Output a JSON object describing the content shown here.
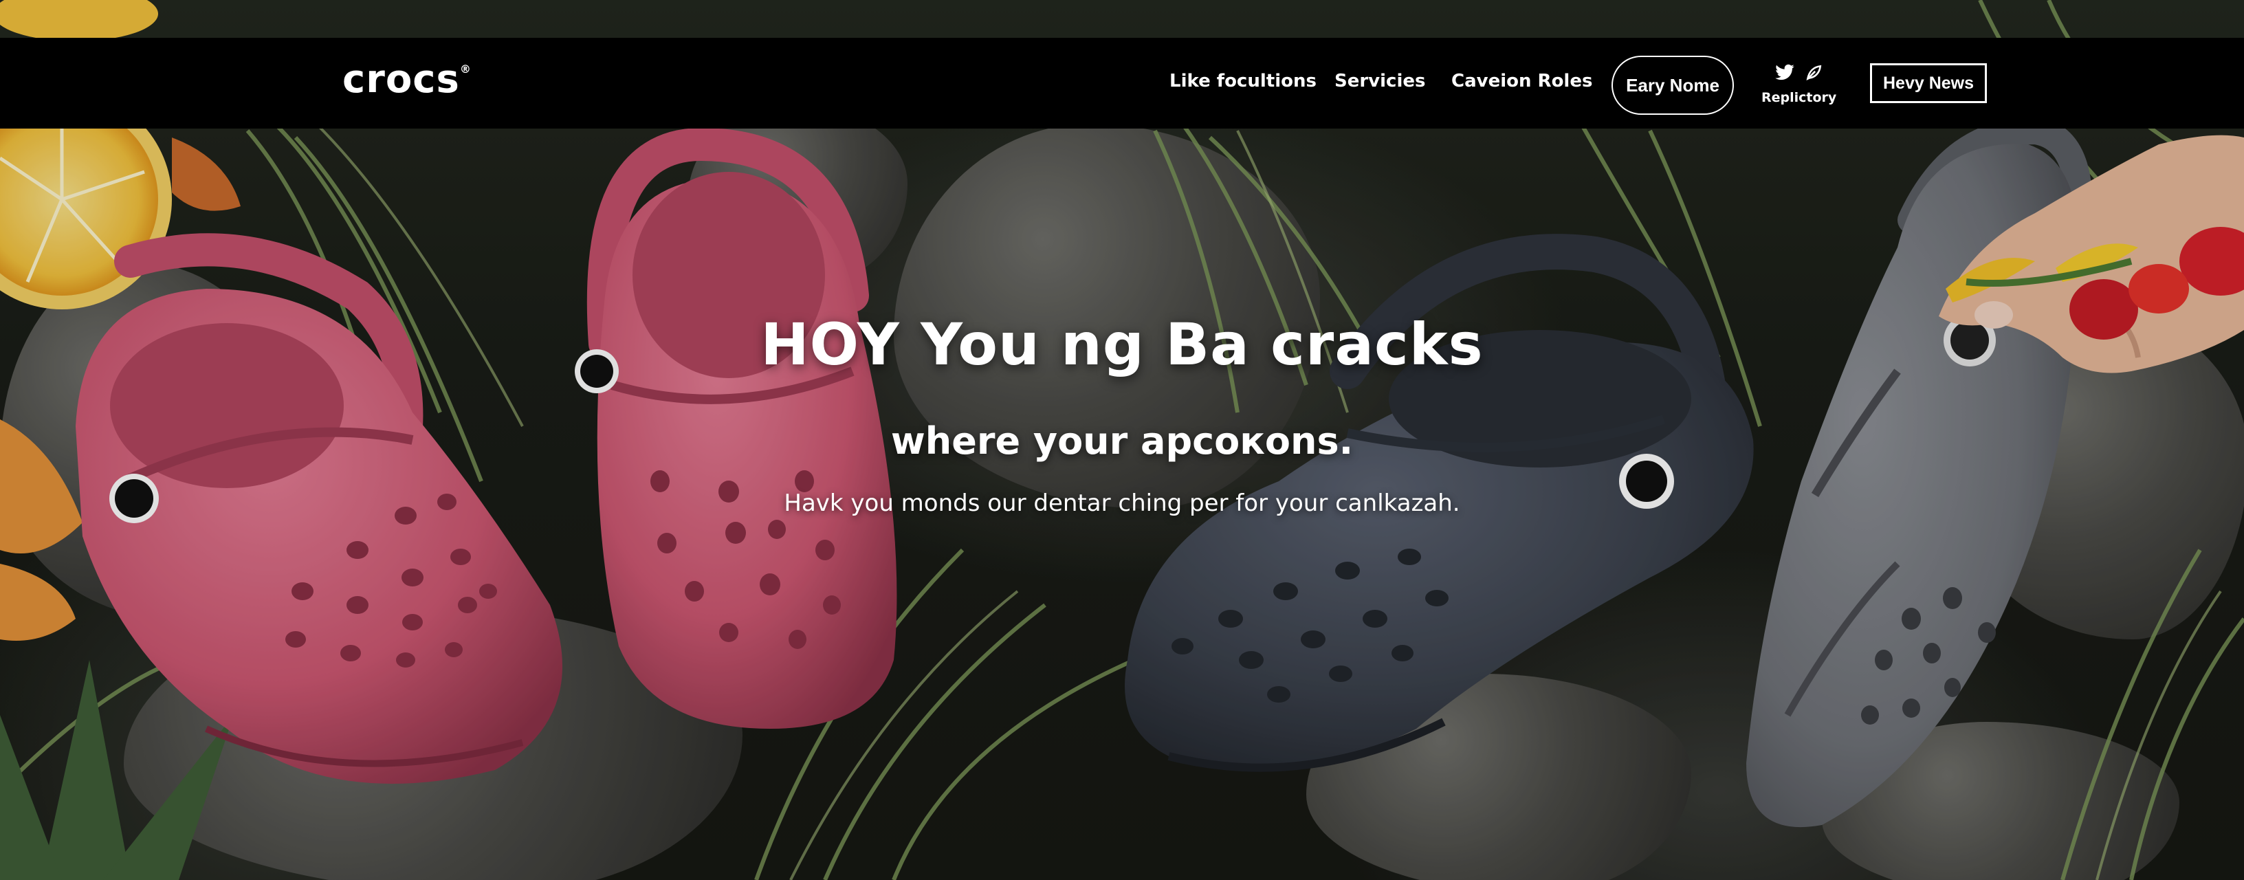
{
  "brand": {
    "logo_text": "crocs",
    "logo_mark": "®"
  },
  "nav": {
    "links": [
      "Like focultions",
      "Servicies",
      "Caveion Roles"
    ],
    "pill_button": "Eary Nome",
    "social_label": "Replictory",
    "social_icons": [
      "twitter-icon",
      "leaf-icon"
    ],
    "box_button": "Hevy News"
  },
  "hero": {
    "headline": "HOY You ng Ba cracks",
    "subheadline": "where your apcoкons.",
    "tagline": "Havk you monds our dentar ching per for your canlkazah."
  },
  "colors": {
    "nav_background": "#000000",
    "pink_clog": "#d4607a",
    "navy_clog": "#3c424d",
    "grey_clog": "#6f7278"
  }
}
